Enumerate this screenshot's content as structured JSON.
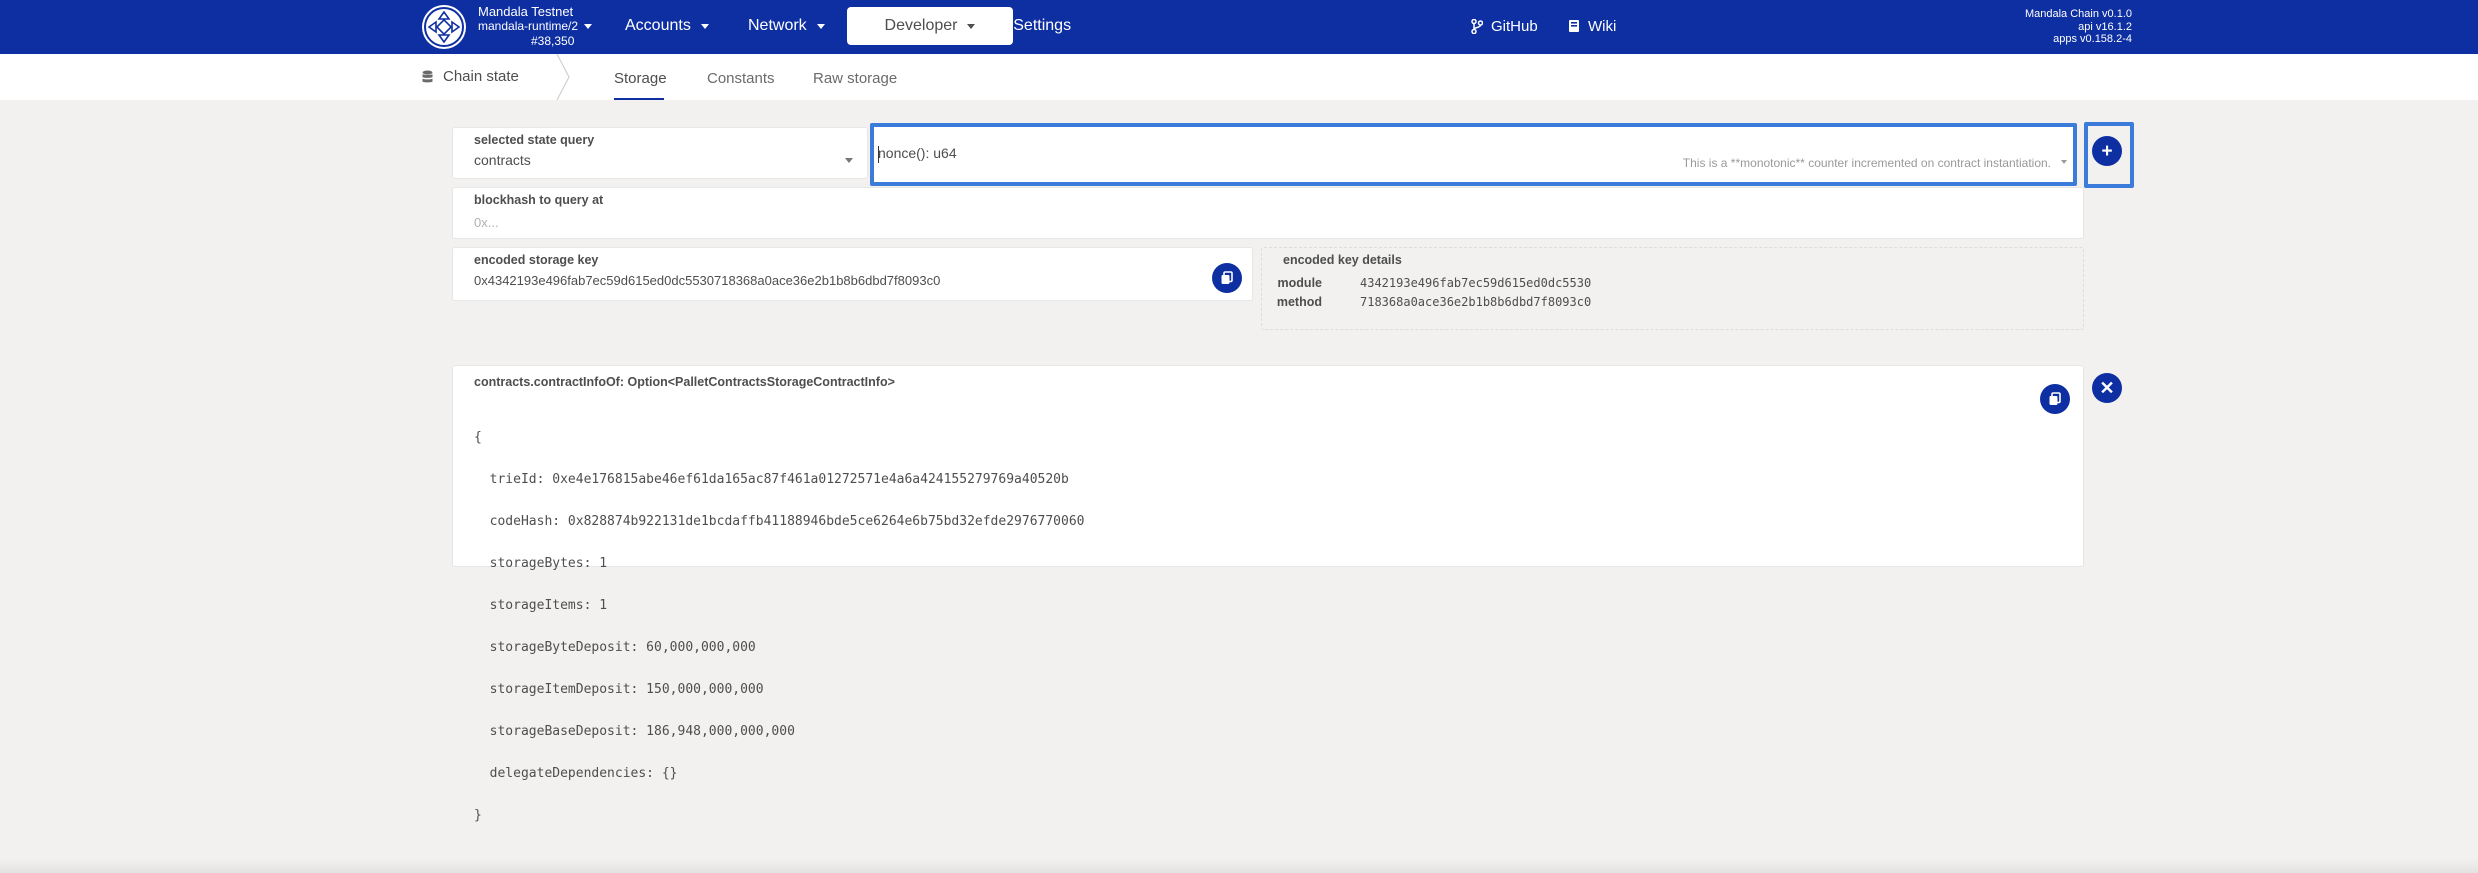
{
  "header": {
    "chain_name": "Mandala Testnet",
    "runtime": "mandala-runtime/2",
    "block": "#38,350",
    "nav": {
      "accounts": "Accounts",
      "network": "Network",
      "developer": "Developer",
      "settings": "Settings"
    },
    "links": {
      "github": "GitHub",
      "wiki": "Wiki"
    },
    "versions": [
      "Mandala Chain v0.1.0",
      "api v16.1.2",
      "apps v0.158.2-4"
    ]
  },
  "subnav": {
    "section": "Chain state",
    "tabs": [
      "Storage",
      "Constants",
      "Raw storage"
    ],
    "active_tab": "Storage"
  },
  "query": {
    "state_label": "selected state query",
    "state_value": "contracts",
    "method_value": "nonce(): u64",
    "method_doc": "This is a **monotonic** counter incremented on contract instantiation.",
    "blockhash_label": "blockhash to query at",
    "blockhash_placeholder": "0x..."
  },
  "encoded": {
    "key_label": "encoded storage key",
    "key_value": "0x4342193e496fab7ec59d615ed0dc5530718368a0ace36e2b1b8b6dbd7f8093c0",
    "details_label": "encoded key details",
    "module_label": "module",
    "module_value": "4342193e496fab7ec59d615ed0dc5530",
    "method_label": "method",
    "method_value": "718368a0ace36e2b1b8b6dbd7f8093c0"
  },
  "result": {
    "title": "contracts.contractInfoOf: Option<PalletContractsStorageContractInfo>",
    "lines": [
      "{",
      "  trieId: 0xe4e176815abe46ef61da165ac87f461a01272571e4a6a424155279769a40520b",
      "  codeHash: 0x828874b922131de1bcdaffb41188946bde5ce6264e6b75bd32efde2976770060",
      "  storageBytes: 1",
      "  storageItems: 1",
      "  storageByteDeposit: 60,000,000,000",
      "  storageItemDeposit: 150,000,000,000",
      "  storageBaseDeposit: 186,948,000,000,000",
      "  delegateDependencies: {}",
      "}"
    ]
  },
  "icons": {
    "logo": "mandala-logo-icon",
    "settings": "gear-icon",
    "github": "git-branch-icon",
    "wiki": "book-icon",
    "section": "database-icon",
    "add": "plus-icon",
    "copy": "copy-icon",
    "close": "close-icon"
  },
  "colors": {
    "accent": "#0d2fa1",
    "focus": "#3b7bd9",
    "background": "#f2f1f0"
  }
}
